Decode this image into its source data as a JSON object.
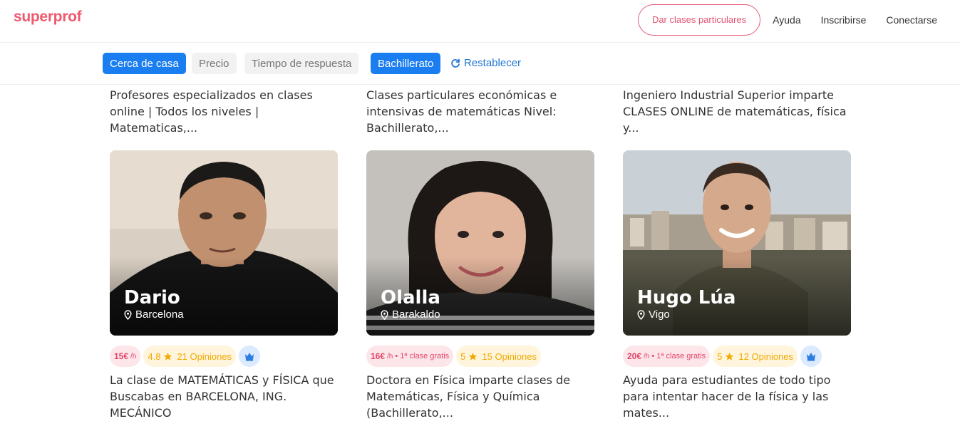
{
  "header": {
    "logo": "superprof",
    "give_classes": "Dar clases particulares",
    "help": "Ayuda",
    "signup": "Inscribirse",
    "login": "Conectarse"
  },
  "filters": {
    "near_home": "Cerca de casa",
    "price": "Precio",
    "response_time": "Tiempo de respuesta",
    "level": "Bachillerato",
    "reset": "Restablecer"
  },
  "top_descriptions": [
    "Profesores especializados en clases online | Todos los niveles | Matematicas,...",
    "Clases particulares económicas e intensivas de matemáticas Nivel: Bachillerato,...",
    "Ingeniero Industrial Superior imparte CLASES ONLINE de matemáticas, física y..."
  ],
  "cards": [
    {
      "name": "Dario",
      "city": "Barcelona",
      "price": "15€",
      "per": "/h",
      "free_class": "",
      "rating": "4.8",
      "reviews": "21 Opiniones",
      "ambassador": true,
      "description": "La clase de MATEMÁTICAS y FÍSICA que Buscabas en BARCELONA, ING. MECÁNICO"
    },
    {
      "name": "Olalla",
      "city": "Barakaldo",
      "price": "16€",
      "per": "/h",
      "free_class": "• 1ª clase gratis",
      "rating": "5",
      "reviews": "15 Opiniones",
      "ambassador": false,
      "description": "Doctora en Física imparte clases de Matemáticas, Física y Química (Bachillerato,..."
    },
    {
      "name": "Hugo Lúa",
      "city": "Vigo",
      "price": "20€",
      "per": "/h",
      "free_class": "• 1ª clase gratis",
      "rating": "5",
      "reviews": "12 Opiniones",
      "ambassador": true,
      "description": "Ayuda para estudiantes de todo tipo para intentar hacer de la física y las mates..."
    }
  ],
  "colors": {
    "brand": "#ee5a70",
    "accent": "#1a7ef0",
    "link": "#2277d4",
    "price_bg": "#fde6ea",
    "rating_bg": "#fff5dd"
  }
}
